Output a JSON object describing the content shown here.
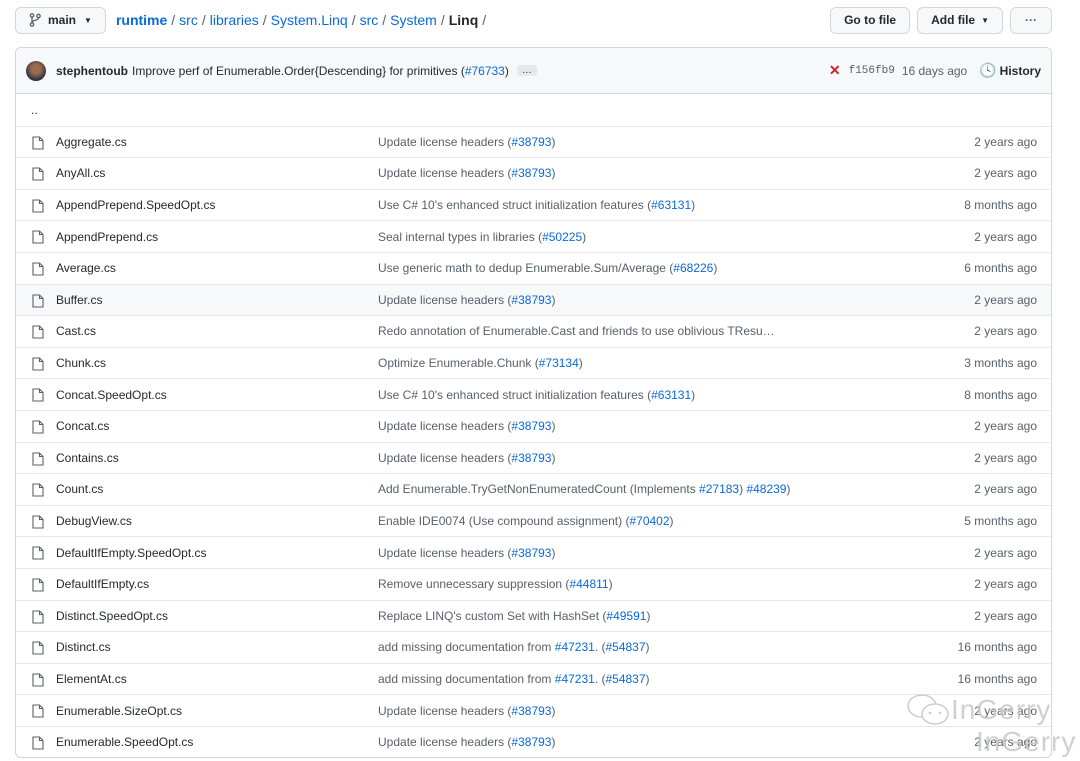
{
  "toolbar": {
    "branch": "main",
    "go_to_file": "Go to file",
    "add_file": "Add file",
    "more": "···"
  },
  "breadcrumb": [
    {
      "label": "runtime",
      "bold": true
    },
    {
      "label": "src"
    },
    {
      "label": "libraries"
    },
    {
      "label": "System.Linq"
    },
    {
      "label": "src"
    },
    {
      "label": "System"
    }
  ],
  "breadcrumb_current": "Linq",
  "commit": {
    "author": "stephentoub",
    "message": "Improve perf of Enumerable.Order{Descending} for primitives (",
    "pr": "#76733",
    "pr_close": ")",
    "ellipsis": "…",
    "status_color": "#cf222e",
    "sha": "f156fb9",
    "time": "16 days ago",
    "history": "History"
  },
  "parent_dir": "..",
  "files": [
    {
      "name": "Aggregate.cs",
      "msg": "Update license headers (",
      "pr": "#38793",
      "end": ")",
      "time": "2 years ago"
    },
    {
      "name": "AnyAll.cs",
      "msg": "Update license headers (",
      "pr": "#38793",
      "end": ")",
      "time": "2 years ago"
    },
    {
      "name": "AppendPrepend.SpeedOpt.cs",
      "msg": "Use C# 10's enhanced struct initialization features (",
      "pr": "#63131",
      "end": ")",
      "time": "8 months ago"
    },
    {
      "name": "AppendPrepend.cs",
      "msg": "Seal internal types in libraries (",
      "pr": "#50225",
      "end": ")",
      "time": "2 years ago"
    },
    {
      "name": "Average.cs",
      "msg": "Use generic math to dedup Enumerable.Sum/Average (",
      "pr": "#68226",
      "end": ")",
      "time": "6 months ago"
    },
    {
      "name": "Buffer.cs",
      "msg": "Update license headers (",
      "pr": "#38793",
      "end": ")",
      "time": "2 years ago",
      "hover": true
    },
    {
      "name": "Cast.cs",
      "msg": "Redo annotation of Enumerable.Cast and friends to use oblivious TResu…",
      "pr": "",
      "end": "",
      "time": "2 years ago"
    },
    {
      "name": "Chunk.cs",
      "msg": "Optimize Enumerable.Chunk (",
      "pr": "#73134",
      "end": ")",
      "time": "3 months ago"
    },
    {
      "name": "Concat.SpeedOpt.cs",
      "msg": "Use C# 10's enhanced struct initialization features (",
      "pr": "#63131",
      "end": ")",
      "time": "8 months ago"
    },
    {
      "name": "Concat.cs",
      "msg": "Update license headers (",
      "pr": "#38793",
      "end": ")",
      "time": "2 years ago"
    },
    {
      "name": "Contains.cs",
      "msg": "Update license headers (",
      "pr": "#38793",
      "end": ")",
      "time": "2 years ago"
    },
    {
      "name": "Count.cs",
      "msg": "Add Enumerable.TryGetNonEnumeratedCount (Implements ",
      "pr": "#27183",
      "end": ") ",
      "pr2": "#48239",
      "end2": ")",
      "time": "2 years ago"
    },
    {
      "name": "DebugView.cs",
      "msg": "Enable IDE0074 (Use compound assignment) (",
      "pr": "#70402",
      "end": ")",
      "time": "5 months ago"
    },
    {
      "name": "DefaultIfEmpty.SpeedOpt.cs",
      "msg": "Update license headers (",
      "pr": "#38793",
      "end": ")",
      "time": "2 years ago"
    },
    {
      "name": "DefaultIfEmpty.cs",
      "msg": "Remove unnecessary suppression (",
      "pr": "#44811",
      "end": ")",
      "time": "2 years ago"
    },
    {
      "name": "Distinct.SpeedOpt.cs",
      "msg": "Replace LINQ's custom Set with HashSet (",
      "pr": "#49591",
      "end": ")",
      "time": "2 years ago"
    },
    {
      "name": "Distinct.cs",
      "msg": "add missing documentation from ",
      "pr": "#47231",
      "end": ". (",
      "pr2": "#54837",
      "end2": ")",
      "time": "16 months ago"
    },
    {
      "name": "ElementAt.cs",
      "msg": "add missing documentation from ",
      "pr": "#47231",
      "end": ". (",
      "pr2": "#54837",
      "end2": ")",
      "time": "16 months ago"
    },
    {
      "name": "Enumerable.SizeOpt.cs",
      "msg": "Update license headers (",
      "pr": "#38793",
      "end": ")",
      "time": "2 years ago"
    },
    {
      "name": "Enumerable.SpeedOpt.cs",
      "msg": "Update license headers (",
      "pr": "#38793",
      "end": ")",
      "time": "2 years ago"
    }
  ],
  "watermark": "InGerry"
}
